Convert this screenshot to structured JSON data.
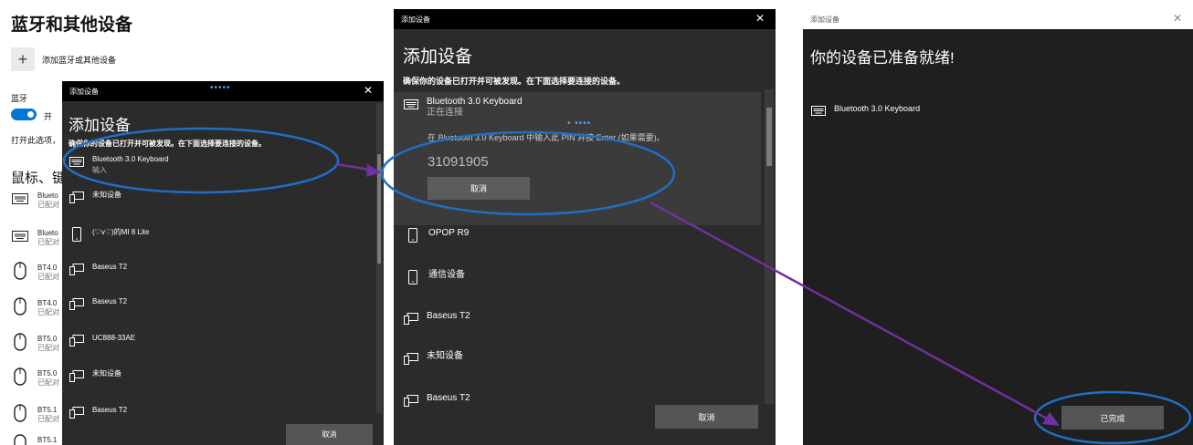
{
  "settings": {
    "title": "蓝牙和其他设备",
    "add_label": "添加蓝牙或其他设备",
    "bluetooth_label": "蓝牙",
    "toggle_state": "开",
    "desc": "打开此选项，",
    "section_title": "鼠标、键",
    "devices": [
      {
        "name": "Blueto",
        "status": "已配对",
        "icon": "keyboard-icon"
      },
      {
        "name": "Blueto",
        "status": "已配对",
        "icon": "keyboard-icon"
      },
      {
        "name": "BT4.0",
        "status": "已配对",
        "icon": "mouse-icon"
      },
      {
        "name": "BT4.0",
        "status": "已配对",
        "icon": "mouse-icon"
      },
      {
        "name": "BT5.0",
        "status": "已配对",
        "icon": "mouse-icon"
      },
      {
        "name": "BT5.0",
        "status": "已配对",
        "icon": "mouse-icon"
      },
      {
        "name": "BT5.1",
        "status": "已配对",
        "icon": "mouse-icon"
      },
      {
        "name": "BT5.1",
        "status": "",
        "icon": "mouse-icon"
      }
    ]
  },
  "dialog1": {
    "window_title": "添加设备",
    "heading": "添加设备",
    "instruction": "确保你的设备已打开并可被发现。在下面选择要连接的设备。",
    "items": [
      {
        "name": "Bluetooth 3.0 Keyboard",
        "status": "输入",
        "icon": "keyboard-icon"
      },
      {
        "name": "未知设备",
        "status": "",
        "icon": "device-icon"
      },
      {
        "name": "(♡v♡)的MI 8 Lite",
        "status": "",
        "icon": "phone-icon"
      },
      {
        "name": "Baseus T2",
        "status": "",
        "icon": "device-icon"
      },
      {
        "name": "Baseus T2",
        "status": "",
        "icon": "device-icon"
      },
      {
        "name": "UC888-33AE",
        "status": "",
        "icon": "device-icon"
      },
      {
        "name": "未知设备",
        "status": "",
        "icon": "device-icon"
      },
      {
        "name": "Baseus T2",
        "status": "",
        "icon": "device-icon"
      }
    ],
    "cancel_label": "取消"
  },
  "dialog2": {
    "window_title": "添加设备",
    "heading": "添加设备",
    "instruction": "确保你的设备已打开并可被发现。在下面选择要连接的设备。",
    "selected": {
      "name": "Bluetooth 3.0 Keyboard",
      "status": "正在连接",
      "prompt": "在 Bluetooth 3.0 Keyboard 中输入此 PIN 并按 Enter (如果需要)。",
      "pin": "31091905",
      "cancel_label": "取消"
    },
    "items": [
      {
        "name": "OPOP   R9",
        "icon": "phone-icon"
      },
      {
        "name": "通信设备",
        "icon": "phone-icon"
      },
      {
        "name": "Baseus T2",
        "icon": "device-icon"
      },
      {
        "name": "未知设备",
        "icon": "device-icon"
      },
      {
        "name": "Baseus T2",
        "icon": "device-icon"
      }
    ],
    "cancel_label": "取消"
  },
  "dialog3": {
    "window_title": "添加设备",
    "heading": "你的设备已准备就绪!",
    "device_name": "Bluetooth 3.0 Keyboard",
    "done_label": "已完成"
  },
  "colors": {
    "annotation_ellipse": "#1f6fc4",
    "annotation_arrow": "#7030a0",
    "accent": "#0078d7"
  }
}
